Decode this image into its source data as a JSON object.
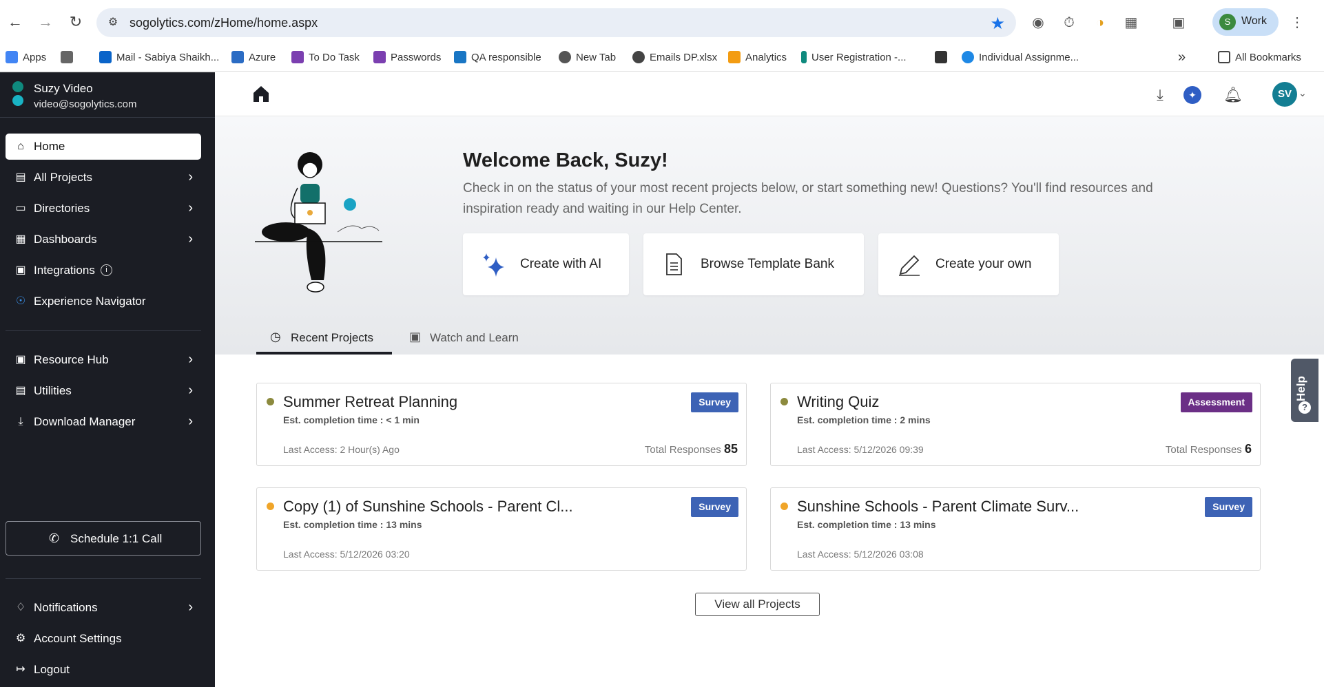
{
  "browser": {
    "url": "sogolytics.com/zHome/home.aspx",
    "profile_initial": "S",
    "profile_label": "Work",
    "bookmarks": [
      "Apps",
      "Mail - Sabiya Shaikh...",
      "Azure",
      "To Do Task",
      "Passwords",
      "QA responsible",
      "New Tab",
      "Emails DP.xlsx",
      "Analytics",
      "User Registration -...",
      "Individual Assignme..."
    ],
    "all_bookmarks": "All Bookmarks"
  },
  "sidebar": {
    "user_name": "Suzy Video",
    "user_email": "video@sogolytics.com",
    "items": [
      {
        "label": "Home",
        "icon": "home-icon"
      },
      {
        "label": "All Projects",
        "icon": "projects-icon"
      },
      {
        "label": "Directories",
        "icon": "folder-icon"
      },
      {
        "label": "Dashboards",
        "icon": "dashboard-icon"
      },
      {
        "label": "Integrations",
        "icon": "integrations-icon"
      },
      {
        "label": "Experience Navigator",
        "icon": "navigator-icon"
      },
      {
        "label": "Resource Hub",
        "icon": "resource-icon"
      },
      {
        "label": "Utilities",
        "icon": "utilities-icon"
      },
      {
        "label": "Download Manager",
        "icon": "download-icon"
      },
      {
        "label": "Notifications",
        "icon": "bell-icon"
      },
      {
        "label": "Account Settings",
        "icon": "gear-icon"
      },
      {
        "label": "Logout",
        "icon": "logout-icon"
      }
    ],
    "schedule_label": "Schedule 1:1 Call"
  },
  "header": {
    "avatar_initials": "SV"
  },
  "hero": {
    "title": "Welcome Back, Suzy!",
    "text": "Check in on the status of your most recent projects below, or start something new! Questions? You'll find resources and inspiration ready and waiting in our Help Center.",
    "actions": [
      "Create with AI",
      "Browse Template Bank",
      "Create your own"
    ],
    "tabs": [
      "Recent Projects",
      "Watch and Learn"
    ]
  },
  "projects": [
    {
      "title": "Summer Retreat Planning",
      "est": "Est. completion time : < 1 min",
      "access": "Last Access: 2 Hour(s) Ago",
      "badge": "Survey",
      "responses_label": "Total Responses",
      "responses": "85",
      "dot_color": "#8c8a3e",
      "badge_color": "#3d63b5"
    },
    {
      "title": "Writing Quiz",
      "est": "Est. completion time : 2 mins",
      "access": "Last Access: 5/12/2026 09:39",
      "badge": "Assessment",
      "responses_label": "Total Responses",
      "responses": "6",
      "dot_color": "#8c8a3e",
      "badge_color": "#6b2f86"
    },
    {
      "title": "Copy (1) of Sunshine Schools - Parent Cl...",
      "est": "Est. completion time : 13 mins",
      "access": "Last Access: 5/12/2026 03:20",
      "badge": "Survey",
      "dot_color": "#f0a529",
      "badge_color": "#3d63b5"
    },
    {
      "title": "Sunshine Schools - Parent Climate Surv...",
      "est": "Est. completion time : 13 mins",
      "access": "Last Access: 5/12/2026 03:08",
      "badge": "Survey",
      "dot_color": "#f0a529",
      "badge_color": "#3d63b5"
    }
  ],
  "view_all": "View all Projects",
  "help_label": "Help"
}
